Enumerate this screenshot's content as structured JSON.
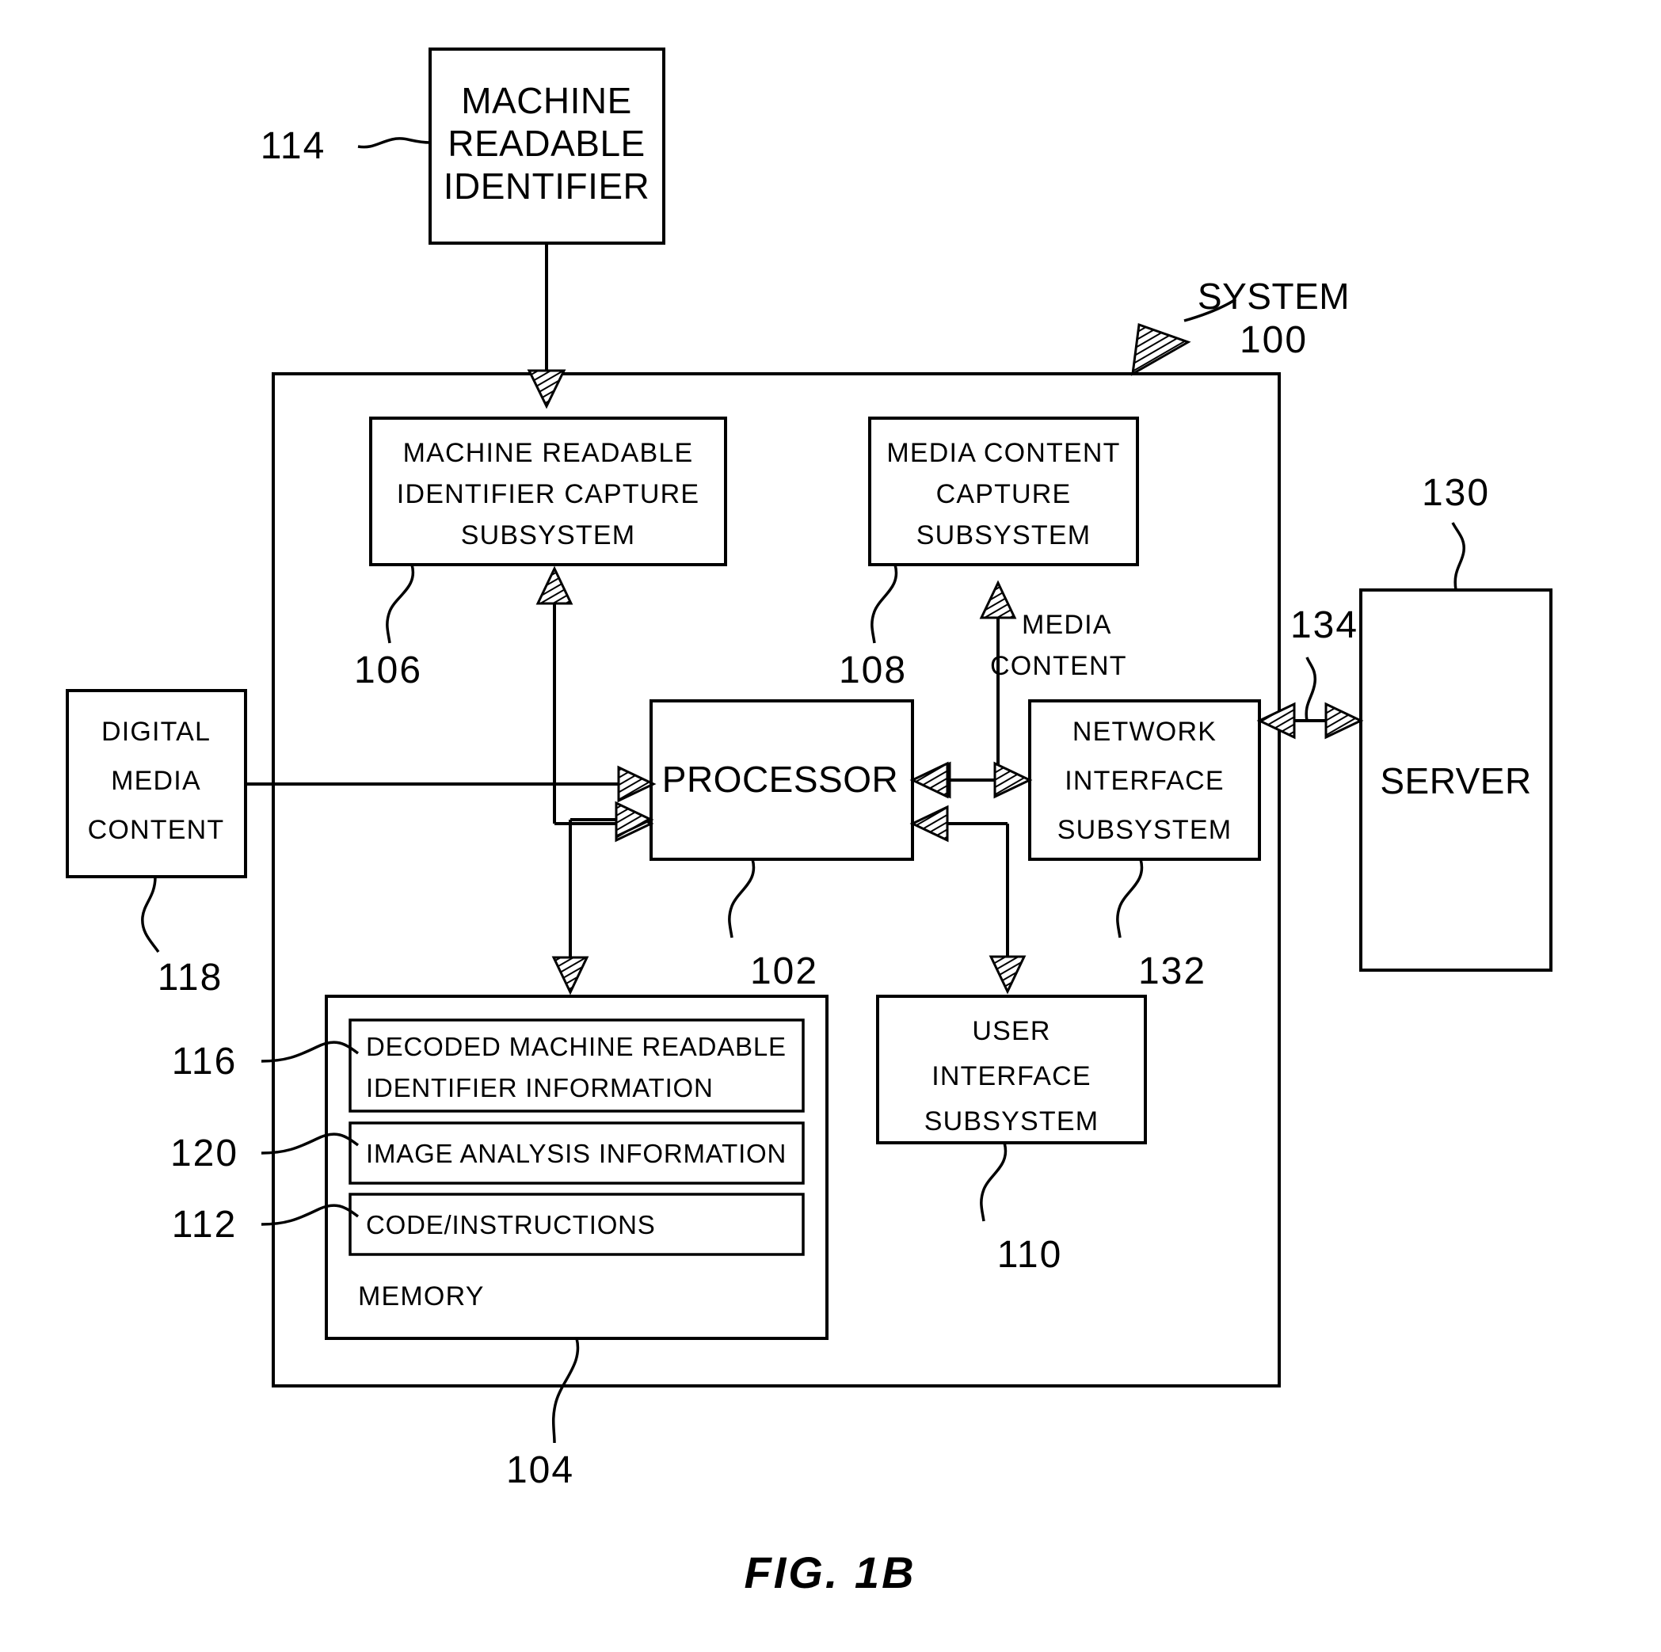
{
  "figure": {
    "caption": "FIG. 1B",
    "system_label_line1": "SYSTEM",
    "system_label_line2": "100"
  },
  "boxes": {
    "machine_readable_identifier": {
      "lines": [
        "MACHINE",
        "READABLE",
        "IDENTIFIER"
      ],
      "ref": "114"
    },
    "mri_capture_subsystem": {
      "lines": [
        "MACHINE READABLE",
        "IDENTIFIER CAPTURE",
        "SUBSYSTEM"
      ],
      "ref": "106"
    },
    "media_content_capture_subsystem": {
      "lines": [
        "MEDIA CONTENT",
        "CAPTURE",
        "SUBSYSTEM"
      ],
      "ref": "108"
    },
    "digital_media_content": {
      "lines": [
        "DIGITAL",
        "MEDIA",
        "CONTENT"
      ],
      "ref": "118"
    },
    "processor": {
      "lines": [
        "PROCESSOR"
      ],
      "ref": "102"
    },
    "network_interface_subsystem": {
      "lines": [
        "NETWORK",
        "INTERFACE",
        "SUBSYSTEM"
      ],
      "ref": "132"
    },
    "server": {
      "lines": [
        "SERVER"
      ],
      "ref": "130"
    },
    "user_interface_subsystem": {
      "lines": [
        "USER",
        "INTERFACE",
        "SUBSYSTEM"
      ],
      "ref": "110"
    },
    "memory": {
      "label": "MEMORY",
      "ref": "104"
    },
    "decoded_mri_information": {
      "lines": [
        "DECODED MACHINE READABLE",
        "IDENTIFIER INFORMATION"
      ],
      "ref": "116"
    },
    "image_analysis_information": {
      "lines": [
        "IMAGE ANALYSIS INFORMATION"
      ],
      "ref": "120"
    },
    "code_instructions": {
      "lines": [
        "CODE/INSTRUCTIONS"
      ],
      "ref": "112"
    }
  },
  "edge_labels": {
    "media_content": {
      "lines": [
        "MEDIA",
        "CONTENT"
      ]
    },
    "network_link": {
      "ref": "134"
    }
  }
}
